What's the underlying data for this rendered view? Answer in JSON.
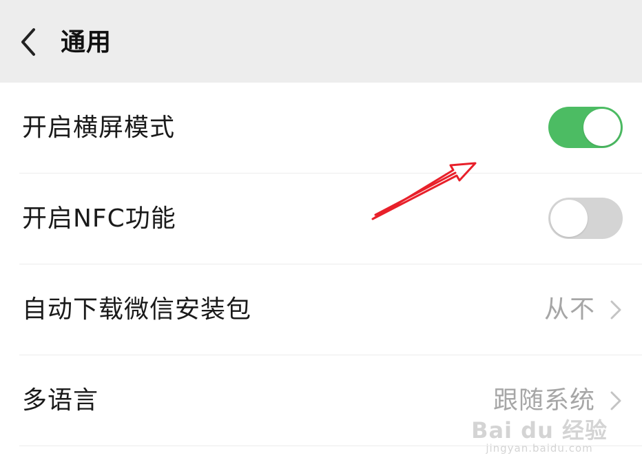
{
  "header": {
    "title": "通用"
  },
  "settings": {
    "landscape": {
      "label": "开启横屏模式",
      "enabled": true
    },
    "nfc": {
      "label": "开启NFC功能",
      "enabled": false
    },
    "auto_download": {
      "label": "自动下载微信安装包",
      "value": "从不"
    },
    "language": {
      "label": "多语言",
      "value": "跟随系统"
    }
  },
  "colors": {
    "toggle_on": "#4cbc63",
    "toggle_off": "#d4d4d4",
    "header_bg": "#ededed",
    "annotation_arrow": "#e8202a"
  },
  "watermark": {
    "logo": "Bai du 经验",
    "url": "jingyan.baidu.com"
  }
}
